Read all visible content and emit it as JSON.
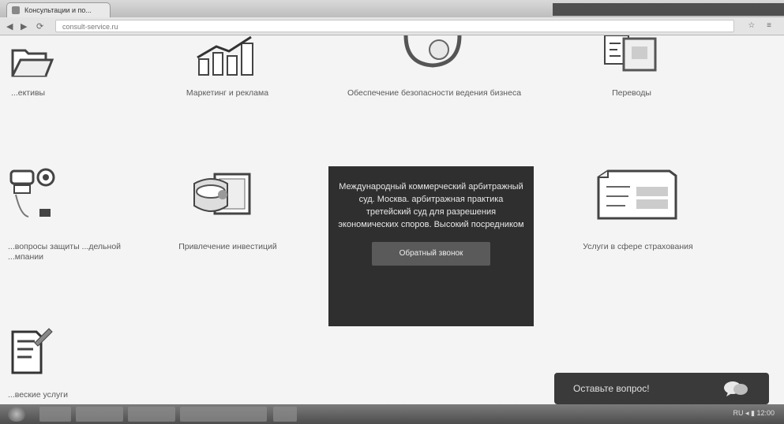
{
  "browser": {
    "tab_title": "Консультации и по...",
    "url": "consult-service.ru",
    "nav": {
      "back": "◀",
      "forward": "▶",
      "reload": "⟳"
    },
    "right_icons": "☆ ≡"
  },
  "items": [
    {
      "label": "...ективы",
      "icon": "folder-icon"
    },
    {
      "label": "Маркетинг и реклама",
      "icon": "growth-chart-icon"
    },
    {
      "label": "Обеспечение безопасности ведения бизнеса",
      "icon": "security-globe-icon"
    },
    {
      "label": "Переводы",
      "icon": "translation-documents-icon"
    },
    {
      "label": "...вопросы защиты ...дельной ...мпании",
      "icon": "property-protection-icon"
    },
    {
      "label": "Привлечение инвестиций",
      "icon": "investment-safe-icon"
    },
    {
      "label": "Услуги в сфере страхования",
      "icon": "insurance-document-icon"
    },
    {
      "label": "...веские услуги",
      "icon": "legal-document-icon"
    }
  ],
  "tile": {
    "text": "Международный коммерческий арбитражный суд. Москва. арбитражная практика третейский суд для разрешения экономических споров. Высокий посредником",
    "button_label": "Обратный звонок"
  },
  "chat": {
    "label": "Оставьте вопрос!",
    "icon": "chat-bubble-icon"
  },
  "taskbar": {
    "tray_text": "RU ◂ ▮ 12:00"
  }
}
